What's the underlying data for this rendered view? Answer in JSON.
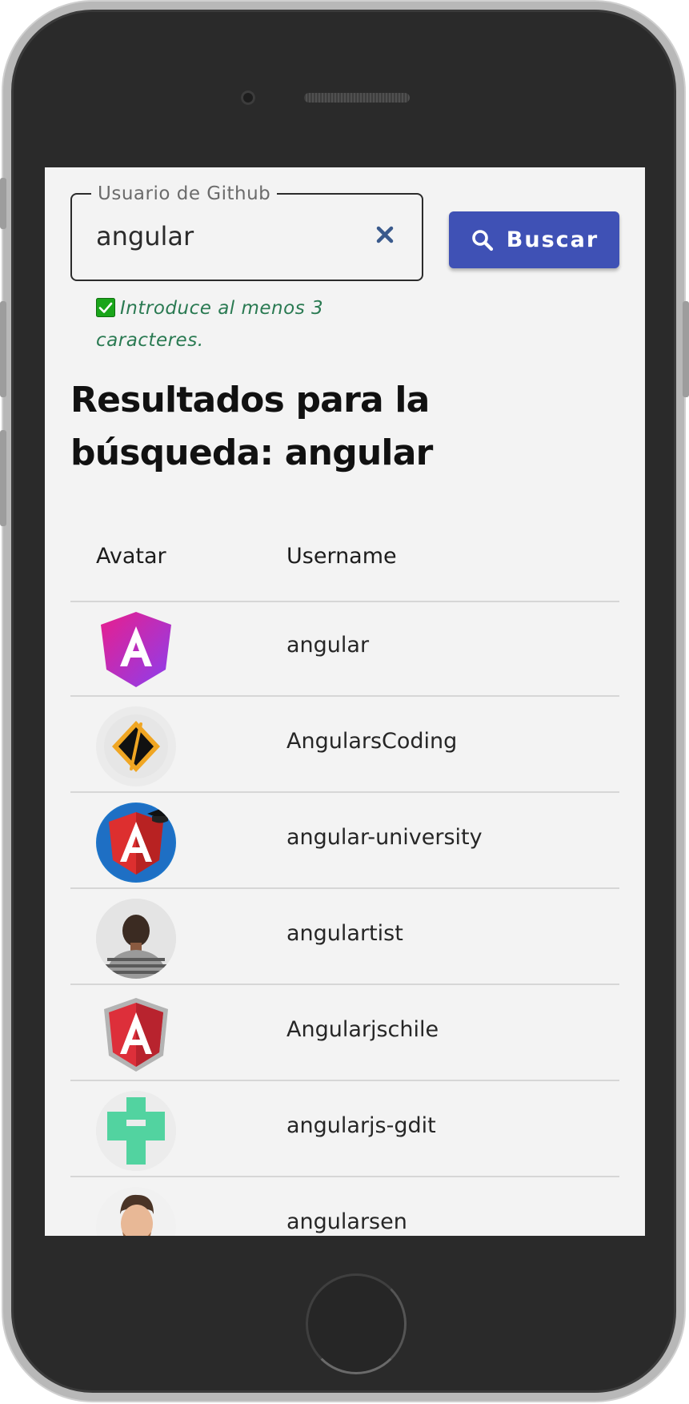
{
  "search": {
    "label": "Usuario de Github",
    "value": "angular",
    "clear_icon": "close-icon",
    "hint": "Introduce al menos 3 caracteres.",
    "hint_icon": "check-icon",
    "button_label": "Buscar",
    "button_icon": "search-icon"
  },
  "results": {
    "title": "Resultados para la búsqueda: angular",
    "columns": [
      "Avatar",
      "Username"
    ],
    "rows": [
      {
        "username": "angular",
        "avatar": "angular-logo-avatar"
      },
      {
        "username": "AngularsCoding",
        "avatar": "coding-logo-avatar"
      },
      {
        "username": "angular-university",
        "avatar": "angular-university-avatar"
      },
      {
        "username": "angulartist",
        "avatar": "person-photo-avatar"
      },
      {
        "username": "Angularjschile",
        "avatar": "angularjs-shield-avatar"
      },
      {
        "username": "angularjs-gdit",
        "avatar": "identicon-avatar"
      },
      {
        "username": "angularsen",
        "avatar": "person-photo-avatar"
      }
    ]
  },
  "colors": {
    "primary": "#3f51b5",
    "hint": "#2a7a52",
    "check": "#1aa51a",
    "clear": "#3a5a8c",
    "screen_bg": "#f3f3f3"
  }
}
